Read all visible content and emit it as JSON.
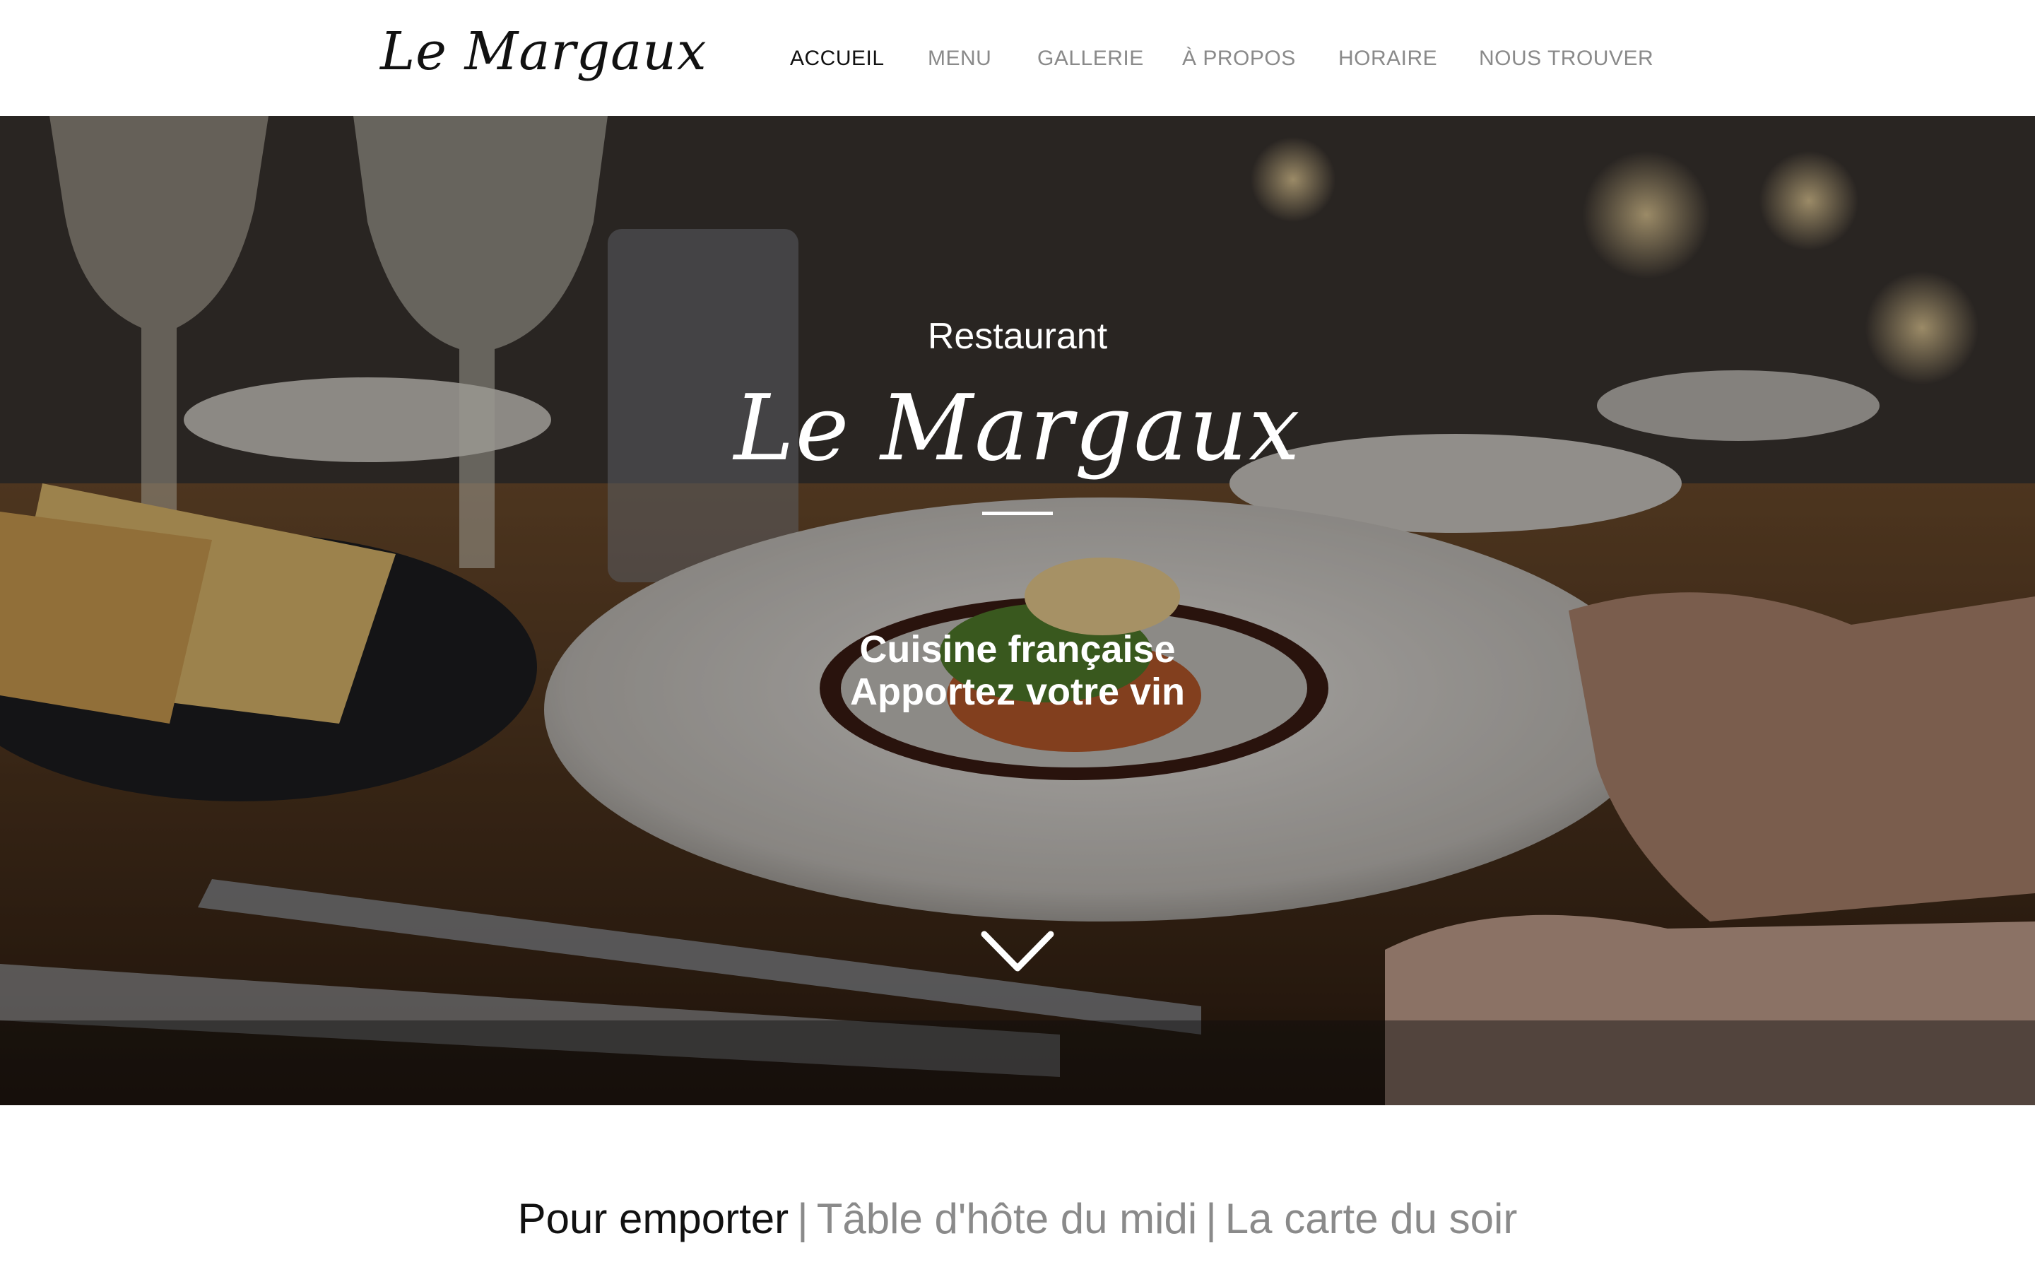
{
  "header": {
    "logo": "Le Margaux",
    "nav": [
      {
        "label": "ACCUEIL",
        "active": true
      },
      {
        "label": "MENU",
        "active": false
      },
      {
        "label": "GALLERIE",
        "active": false
      },
      {
        "label": "À PROPOS",
        "active": false
      },
      {
        "label": "HORAIRE",
        "active": false
      },
      {
        "label": "NOUS TROUVER",
        "active": false
      }
    ]
  },
  "hero": {
    "kicker": "Restaurant",
    "title": "Le Margaux",
    "line1": "Cuisine française",
    "line2": "Apportez votre vin",
    "scroll_icon": "chevron-down-icon"
  },
  "sections": {
    "items": [
      {
        "label": "Pour emporter",
        "active": true
      },
      {
        "label": "Tâble d'hôte du midi",
        "active": false
      },
      {
        "label": "La carte du soir",
        "active": false
      }
    ],
    "separator": "|"
  },
  "colors": {
    "text_dark": "#111111",
    "text_muted": "#8a8a8a",
    "header_bg": "#ffffff",
    "hero_text": "#ffffff"
  }
}
